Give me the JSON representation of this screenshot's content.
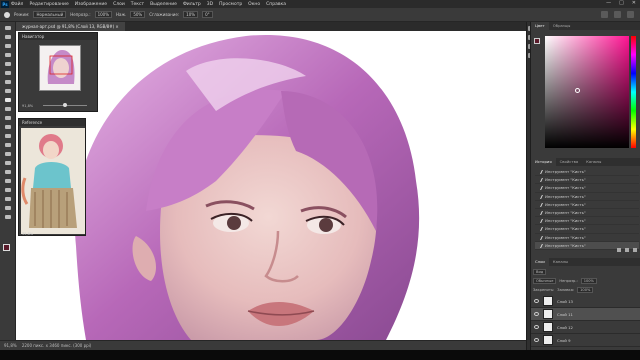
{
  "menubar": {
    "logo": "Ps",
    "items": [
      "Файл",
      "Редактирование",
      "Изображение",
      "Слои",
      "Текст",
      "Выделение",
      "Фильтр",
      "3D",
      "Просмотр",
      "Окно",
      "Справка"
    ],
    "window_buttons": [
      "—",
      "□",
      "✕"
    ]
  },
  "options": {
    "mode_label": "Режим:",
    "mode_value": "Нормальный",
    "opacity_label": "Непрозр.:",
    "opacity_value": "100%",
    "pressure_label": "Нажим:",
    "flow_label": "Наж.",
    "flow_value": "50%",
    "smoothing_label": "Сглаживание:",
    "smoothing_value": "10%",
    "angle_value": "0°"
  },
  "document": {
    "tab_label": "журнал-арт.psd @ 91,8% (Слой 13, RGB/8#)",
    "close": "×"
  },
  "status": {
    "zoom": "91,8%",
    "info": "2200 пикс. x 3460 пикс. (300 ppi)"
  },
  "navigator": {
    "title": "Навигатор",
    "zoom": "91,8%"
  },
  "reference": {
    "title": "Reference",
    "zoom": "35,8%"
  },
  "color_panel": {
    "tabs": [
      "Цвет",
      "Образцы"
    ],
    "accent": "#ff1493"
  },
  "history_panel": {
    "tabs": [
      "История",
      "Свойства",
      "Каналы"
    ],
    "items": [
      "Инструмент \"Кисть\"",
      "Инструмент \"Кисть\"",
      "Инструмент \"Кисть\"",
      "Инструмент \"Кисть\"",
      "Инструмент \"Кисть\"",
      "Инструмент \"Кисть\"",
      "Инструмент \"Кисть\"",
      "Инструмент \"Кисть\"",
      "Инструмент \"Кисть\"",
      "Инструмент \"Кисть\""
    ],
    "selected_index": 9
  },
  "layers_panel": {
    "tabs": [
      "Слои",
      "Каналы"
    ],
    "kind_label": "Вид",
    "blend_mode": "Обычные",
    "opacity_label": "Непрозр.:",
    "opacity_value": "100%",
    "lock_label": "Закрепить:",
    "fill_label": "Заливка:",
    "fill_value": "100%",
    "layers": [
      "Слой 13",
      "Слой 11",
      "Слой 12",
      "Слой 9",
      "Слой 8"
    ],
    "selected_index": 1
  }
}
